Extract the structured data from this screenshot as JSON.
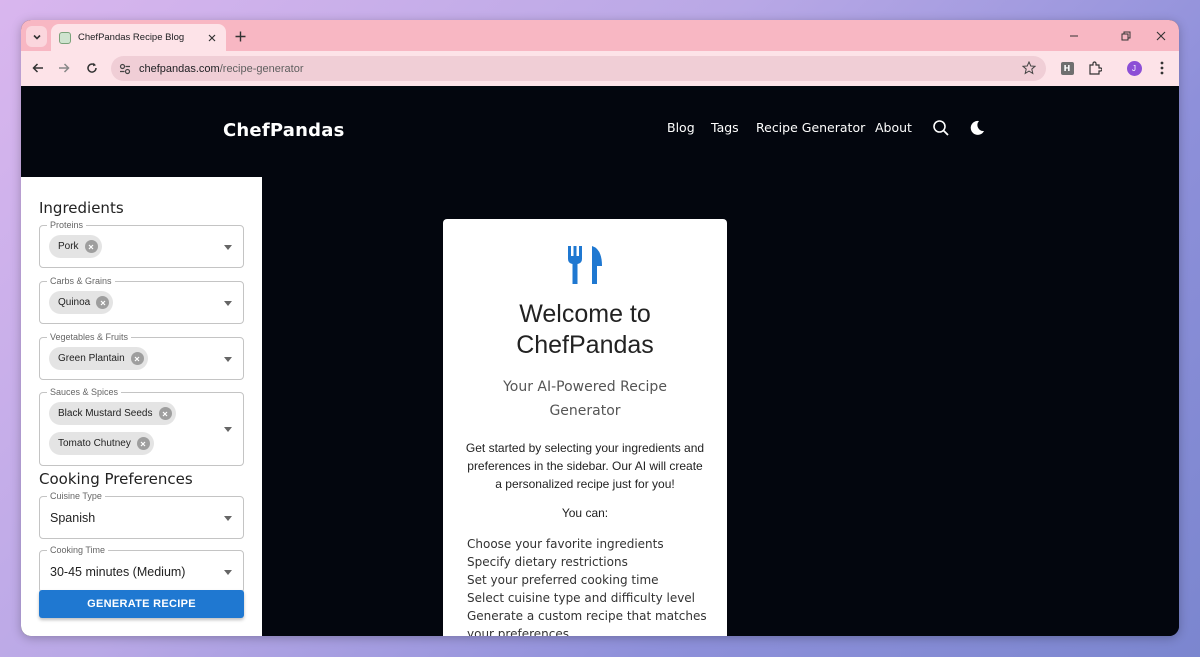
{
  "browser": {
    "tab_title": "ChefPandas Recipe Blog",
    "url_host": "chefpandas.com",
    "url_path": "/recipe-generator",
    "profile_initial": "J",
    "extension_badge": "H"
  },
  "site": {
    "brand": "ChefPandas",
    "nav": [
      "Blog",
      "Tags",
      "Recipe Generator",
      "About"
    ]
  },
  "sidebar": {
    "ingredients_heading": "Ingredients",
    "proteins": {
      "label": "Proteins",
      "chips": [
        "Pork"
      ]
    },
    "carbs": {
      "label": "Carbs & Grains",
      "chips": [
        "Quinoa"
      ]
    },
    "vegetables": {
      "label": "Vegetables & Fruits",
      "chips": [
        "Green Plantain"
      ]
    },
    "sauces": {
      "label": "Sauces & Spices",
      "chips": [
        "Black Mustard Seeds",
        "Tomato Chutney"
      ]
    },
    "preferences_heading": "Cooking Preferences",
    "cuisine": {
      "label": "Cuisine Type",
      "value": "Spanish"
    },
    "cooking_time": {
      "label": "Cooking Time",
      "value": "30-45 minutes (Medium)"
    },
    "generate_label": "GENERATE RECIPE"
  },
  "welcome": {
    "title_line1": "Welcome to",
    "title_line2": "ChefPandas",
    "tagline": "Your AI-Powered Recipe Generator",
    "description": "Get started by selecting your ingredients and preferences in the sidebar. Our AI will create a personalized recipe just for you!",
    "you_can": "You can:",
    "items": [
      "Choose your favorite ingredients",
      "Specify dietary restrictions",
      "Set your preferred cooking time",
      "Select cuisine type and difficulty level",
      "Generate a custom recipe that matches your preferences"
    ]
  },
  "colors": {
    "accent": "#1f78d1",
    "tabstrip": "#f8b7c3",
    "page_bg": "#03060e"
  }
}
